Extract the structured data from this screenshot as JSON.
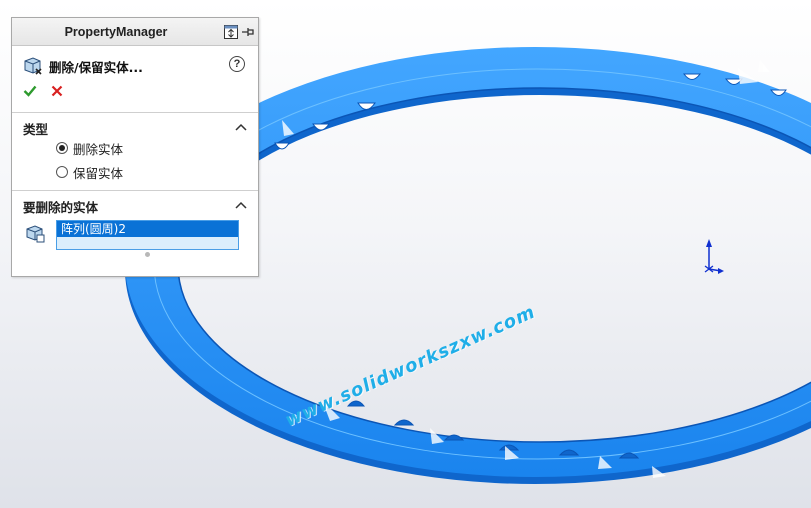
{
  "panel": {
    "title": "PropertyManager",
    "feature_title": "删除/保留实体...",
    "help_glyph": "?",
    "icons": [
      "feature-icon",
      "check-icon",
      "close-icon",
      "help-icon",
      "display-pane-icon",
      "pin-icon",
      "chevron-up-icon",
      "solid-body-icon"
    ]
  },
  "type_section": {
    "title": "类型",
    "options": [
      {
        "label": "删除实体",
        "selected": true
      },
      {
        "label": "保留实体",
        "selected": false
      }
    ]
  },
  "bodies_section": {
    "title": "要删除的实体",
    "selected_item": "阵列(圆周)2"
  },
  "watermark": "www.solidworkszxw.com",
  "colors": {
    "model": "#1e8cf0",
    "model_dark": "#0e62c8",
    "selection": "#0a72d6",
    "axis": "#1030d0"
  }
}
